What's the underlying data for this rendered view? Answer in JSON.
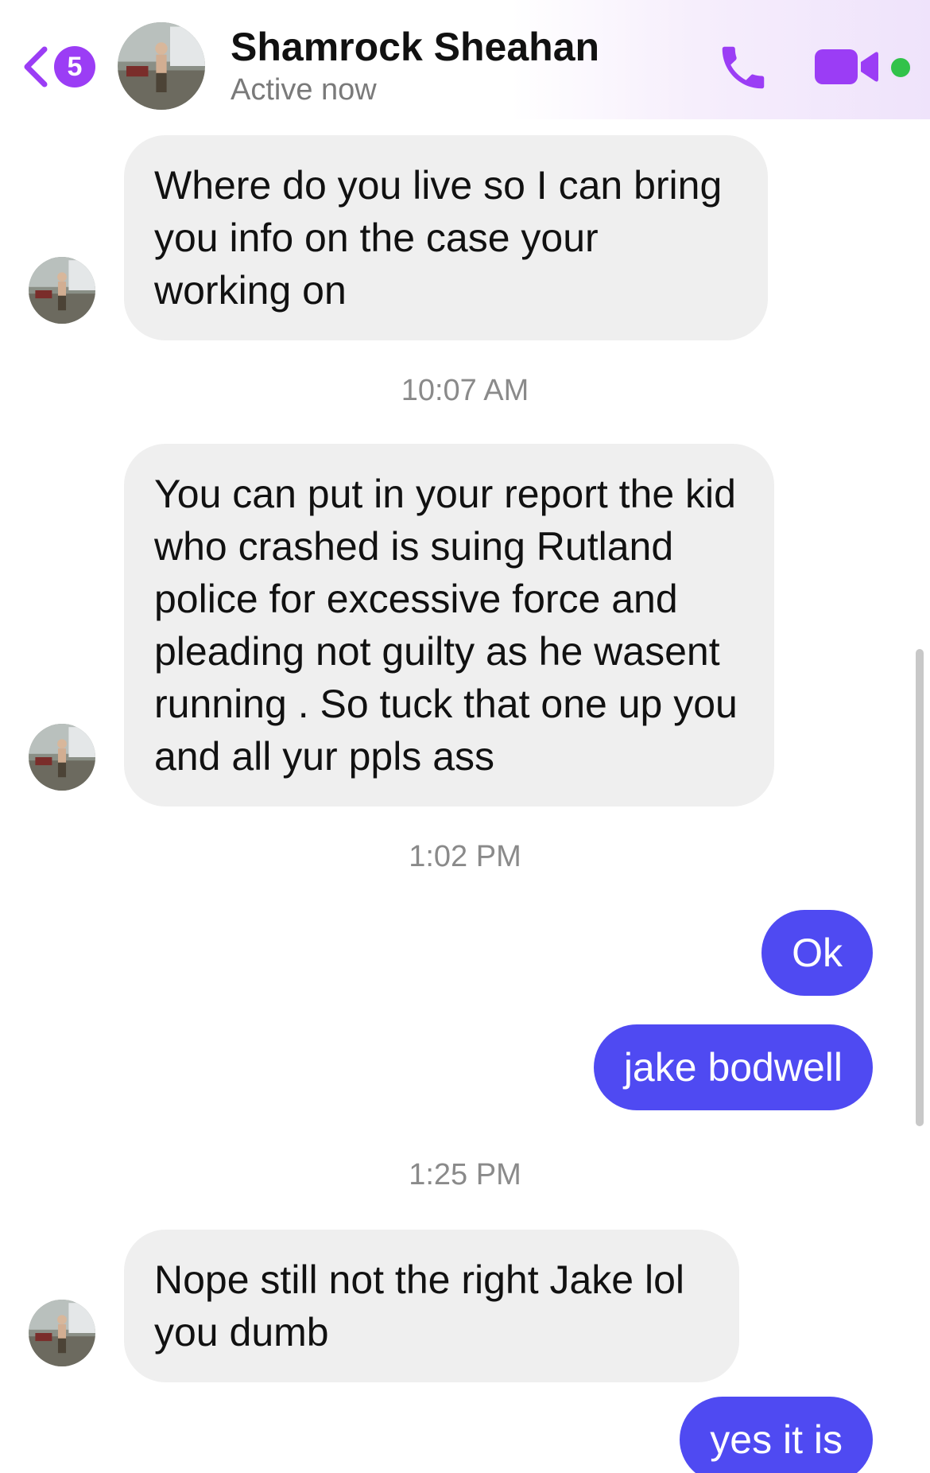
{
  "header": {
    "back_badge_count": "5",
    "contact_name": "Shamrock Sheahan",
    "contact_status": "Active now",
    "icons": {
      "back": "chevron-left-icon",
      "call": "phone-icon",
      "video": "video-camera-icon"
    },
    "accent_color": "#9b3df5",
    "online_color": "#31c24a"
  },
  "messages": [
    {
      "direction": "incoming",
      "text": "Where do you live so I can bring you info on the case your working on"
    },
    {
      "timestamp": "10:07 AM"
    },
    {
      "direction": "incoming",
      "text": "You can put in your report the kid who crashed is suing Rutland police for excessive force and pleading not guilty as he wasent running . So tuck that one up you and all yur ppls ass"
    },
    {
      "timestamp": "1:02 PM"
    },
    {
      "direction": "outgoing",
      "text": "Ok"
    },
    {
      "direction": "outgoing",
      "text": "jake bodwell"
    },
    {
      "timestamp": "1:25 PM"
    },
    {
      "direction": "incoming",
      "text": "Nope still not the right Jake lol you dumb"
    },
    {
      "direction": "outgoing",
      "text": "yes it is"
    }
  ],
  "colors": {
    "incoming_bubble": "#efefef",
    "outgoing_bubble": "#4f4af2"
  }
}
